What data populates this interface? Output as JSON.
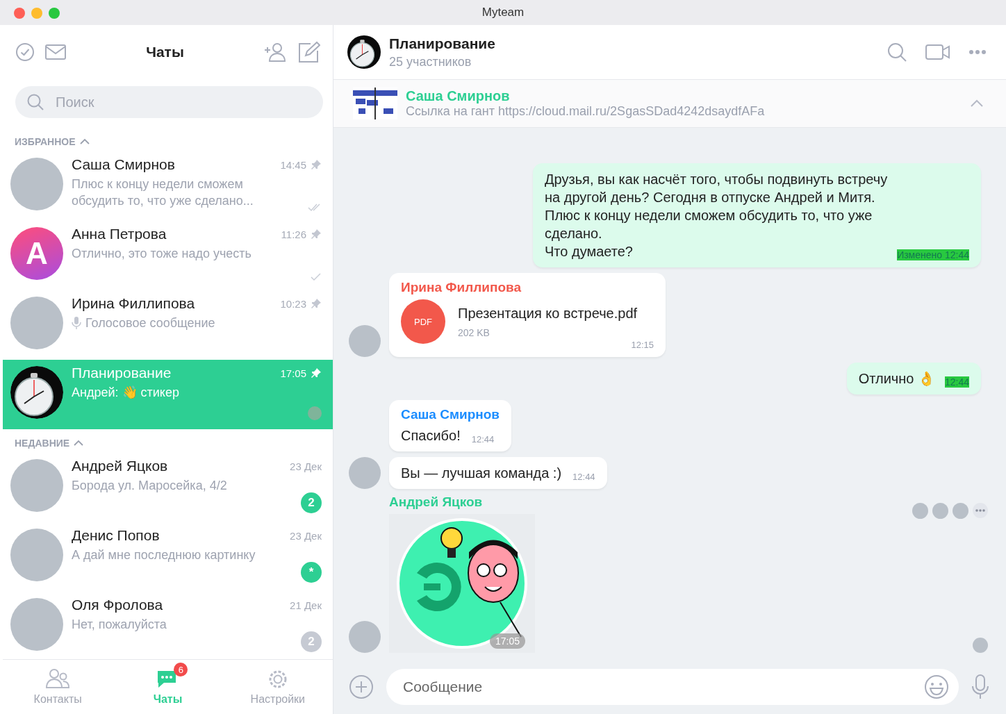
{
  "window": {
    "title": "Myteam"
  },
  "sidebar": {
    "title": "Чаты",
    "search": {
      "placeholder": "Поиск"
    },
    "sections": [
      {
        "title": "ИЗБРАННОЕ",
        "expanded": true,
        "chats": [
          {
            "name": "Саша Смирнов",
            "preview": "Плюс к концу недели сможем обсудить то, что уже сделано...",
            "time": "14:45",
            "pinned": true,
            "group": false,
            "delivered": false,
            "read": true,
            "seen": false,
            "selected": false
          },
          {
            "name": "Анна Петрова",
            "preview": "Отлично, это тоже надо учесть",
            "time": "11:26",
            "pinned": true,
            "group": false,
            "letter": "А",
            "delivered": true,
            "read": false,
            "seen": false,
            "selected": false
          },
          {
            "name": "Ирина Филлипова",
            "preview": "Голосовое сообщение",
            "voice": true,
            "time": "10:23",
            "pinned": true,
            "group": false,
            "delivered": false,
            "read": false,
            "seen": false,
            "selected": false
          },
          {
            "name": "Планирование",
            "preview": "Андрей: 👋 стикер",
            "time": "17:05",
            "pinned": true,
            "group": true,
            "delivered": false,
            "read": false,
            "seen": true,
            "selected": true
          }
        ]
      },
      {
        "title": "НЕДАВНИЕ",
        "expanded": true,
        "chats": [
          {
            "name": "Андрей Яцков",
            "preview": "Борода ул. Маросейка, 4/2",
            "time": "23 Дек",
            "pinned": false,
            "group": false,
            "delivered": false,
            "read": false,
            "seen": false,
            "badge": "2",
            "muted": false,
            "selected": false
          },
          {
            "name": "Денис Попов",
            "preview": "А дай мне последнюю картинку",
            "time": "23 Дек",
            "pinned": false,
            "group": false,
            "delivered": false,
            "read": false,
            "seen": false,
            "badge": "*",
            "muted": false,
            "selected": false
          },
          {
            "name": "Оля Фролова",
            "preview": "Нет, пожалуйста",
            "time": "21 Дек",
            "pinned": false,
            "group": false,
            "delivered": false,
            "read": false,
            "seen": false,
            "badge": "2",
            "muted": true,
            "selected": false
          }
        ]
      }
    ]
  },
  "nav": [
    {
      "label": "Контакты",
      "kind": "contacts",
      "selected": false
    },
    {
      "label": "Чаты",
      "kind": "chats",
      "selected": true,
      "badge": "6"
    },
    {
      "label": "Настройки",
      "kind": "settings",
      "selected": false
    }
  ],
  "chat": {
    "title": "Планирование",
    "subtitle": "25 участников",
    "pinned": {
      "author": "Саша Смирнов",
      "text": "Ссылка на гант https://cloud.mail.ru/2SgasSDad4242dsaydfAFa"
    },
    "messages": [
      {
        "kind": "outgoing",
        "text": "Друзья, вы как насчёт того, чтобы подвинуть встречу\nна другой день? Сегодня в отпуске Андрей и Митя.\nПлюс к концу недели сможем обсудить то, что уже\nсделано.\nЧто думаете?",
        "time": "Изменено 12:44"
      },
      {
        "kind": "file",
        "author": "Ирина Филлипова",
        "color": "#f2584b",
        "file_name": "Презентация ко встрече.pdf",
        "file_type": "PDF",
        "size": "202 KB",
        "time": "12:15",
        "avatar": true
      },
      {
        "kind": "outgoing",
        "text": "Отлично 👌",
        "time": "12:44"
      },
      {
        "kind": "incoming",
        "author": "Саша Смирнов",
        "color": "#1a8cff",
        "text": "Спасибо!",
        "time": "12:44",
        "avatar": false
      },
      {
        "kind": "incoming",
        "text": "Вы — лучшая команда :)",
        "time": "12:44",
        "avatar": true
      },
      {
        "kind": "sticker",
        "author": "Андрей Яцков",
        "color": "#2dcf93",
        "time": "17:05",
        "avatar": true
      }
    ]
  },
  "composer": {
    "placeholder": "Сообщение"
  }
}
